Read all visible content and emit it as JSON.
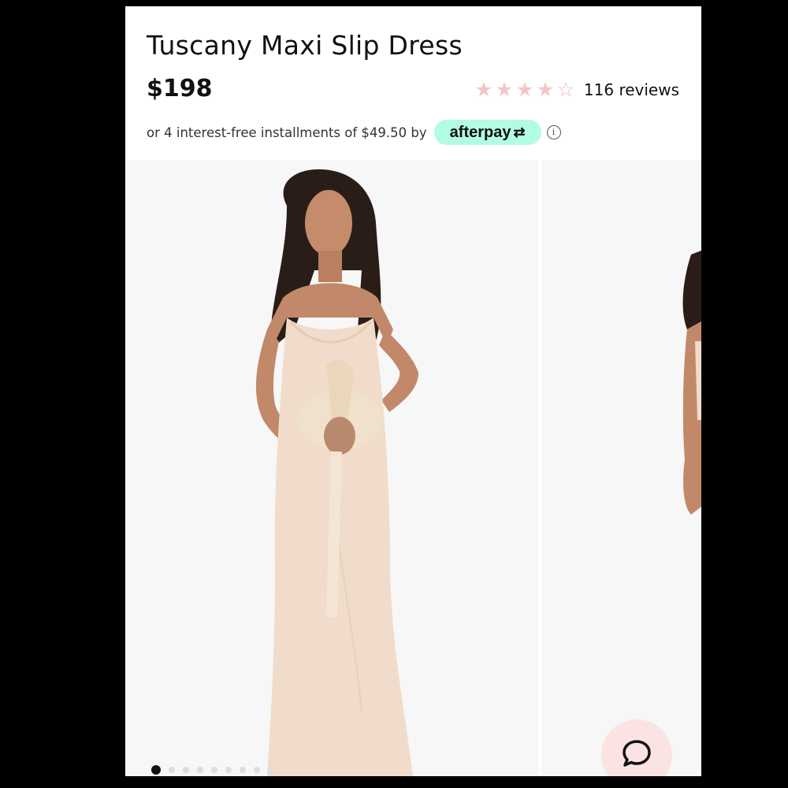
{
  "product": {
    "title": "Tuscany Maxi Slip Dress",
    "price": "$198",
    "rating": 4,
    "rating_max": 5,
    "reviews_label": "116 reviews"
  },
  "afterpay": {
    "installment_text": "or 4 interest-free installments of $49.50 by",
    "brand": "afterpay",
    "info_icon": "info-icon"
  },
  "gallery": {
    "images": [
      "model-front-photo",
      "model-side-photo"
    ],
    "current_index": 0,
    "dot_count": 9
  },
  "chat": {
    "icon": "chat-bubble-icon"
  },
  "colors": {
    "star": "#f4c4c6",
    "afterpay_badge": "#b2fce4",
    "chat_button": "#fbe3e3",
    "dress": "#f1dccb"
  }
}
